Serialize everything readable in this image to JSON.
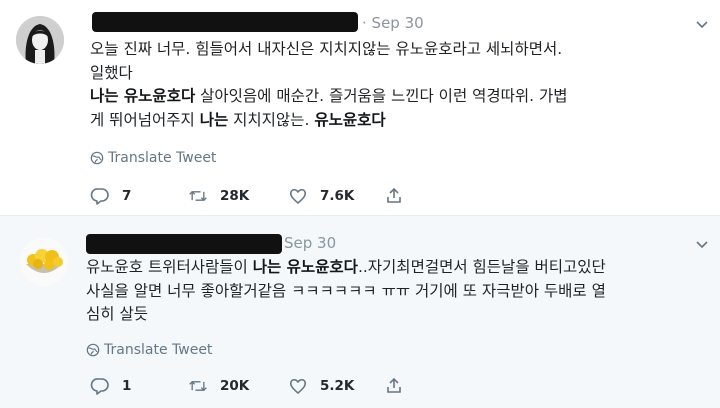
{
  "tweets": [
    {
      "date": "Sep 30",
      "body_lines": [
        [
          {
            "text": "오늘 진짜 너무. 힘들어서 내자신은 지치지않는 유노윤호라고 세뇌하면서.",
            "bold": false
          }
        ],
        [
          {
            "text": "일했다",
            "bold": false
          }
        ],
        [
          {
            "text": "나는 유노윤호다",
            "bold": true
          },
          {
            "text": " 살아잇음에 매순간. 즐거움을 느낀다 이런 역경따위. 가볍",
            "bold": false
          }
        ],
        [
          {
            "text": "게 뛰어넘어주지 ",
            "bold": false
          },
          {
            "text": "나는",
            "bold": true
          },
          {
            "text": " 지치지않는. ",
            "bold": false
          },
          {
            "text": "유노윤호다",
            "bold": true
          }
        ]
      ],
      "translate_label": "Translate Tweet",
      "replies": "7",
      "retweets": "28K",
      "likes": "7.6K",
      "avatar_icon": "dark-haired-character-avatar"
    },
    {
      "date": "Sep 30",
      "body_lines": [
        [
          {
            "text": "유노윤호 트위터사람들이 ",
            "bold": false
          },
          {
            "text": "나는 유노윤호다",
            "bold": true
          },
          {
            "text": "..자기최면걸면서 힘든날을 버티고있단",
            "bold": false
          }
        ],
        [
          {
            "text": "사실을 알면 너무 좋아할거같음 ㅋㅋㅋㅋㅋㅋ ㅠㅠ 거기에 또 자극받아 두배로 열",
            "bold": false
          }
        ],
        [
          {
            "text": "심히 살듯",
            "bold": false
          }
        ]
      ],
      "translate_label": "Translate Tweet",
      "replies": "1",
      "retweets": "20K",
      "likes": "5.2K",
      "avatar_icon": "popcorn-bowl-avatar"
    }
  ],
  "colors": {
    "meta_gray": "#8a959e",
    "icon_gray": "#657786",
    "reply_background": "#f5f8fa",
    "redaction": "#111111"
  }
}
